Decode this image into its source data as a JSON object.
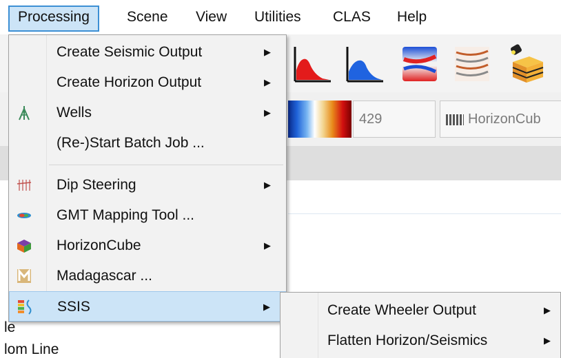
{
  "menubar": {
    "items": [
      "Processing",
      "Scene",
      "View",
      "Utilities",
      "CLAS",
      "Help"
    ]
  },
  "processing_menu": {
    "items": [
      {
        "label": "Create Seismic Output",
        "icon": "",
        "submenu": true
      },
      {
        "label": "Create Horizon Output",
        "icon": "",
        "submenu": true
      },
      {
        "label": "Wells",
        "icon": "well-icon",
        "submenu": true
      },
      {
        "label": "(Re-)Start Batch Job ...",
        "icon": "",
        "submenu": false
      },
      {
        "label": "Dip Steering",
        "icon": "dip-steering-icon",
        "submenu": true
      },
      {
        "label": "GMT Mapping Tool ...",
        "icon": "gmt-icon",
        "submenu": false
      },
      {
        "label": "HorizonCube",
        "icon": "horizoncube-icon",
        "submenu": true
      },
      {
        "label": "Madagascar ...",
        "icon": "madagascar-icon",
        "submenu": false
      },
      {
        "label": "SSIS",
        "icon": "ssis-icon",
        "submenu": true,
        "highlighted": true
      }
    ]
  },
  "ssis_submenu": {
    "items": [
      {
        "label": "Create Wheeler Output",
        "submenu": true
      },
      {
        "label": "Flatten Horizon/Seismics",
        "submenu": true
      }
    ]
  },
  "background": {
    "number_field_value": "429",
    "horizoncube_label": "HorizonCub",
    "tree_partial_1": "le",
    "tree_partial_2": "lom Line"
  },
  "colors": {
    "menu_highlight": "#cce4f7",
    "menu_highlight_border": "#3c8fd4",
    "menu_background": "#f2f2f2"
  },
  "arrow_glyph": "▶"
}
